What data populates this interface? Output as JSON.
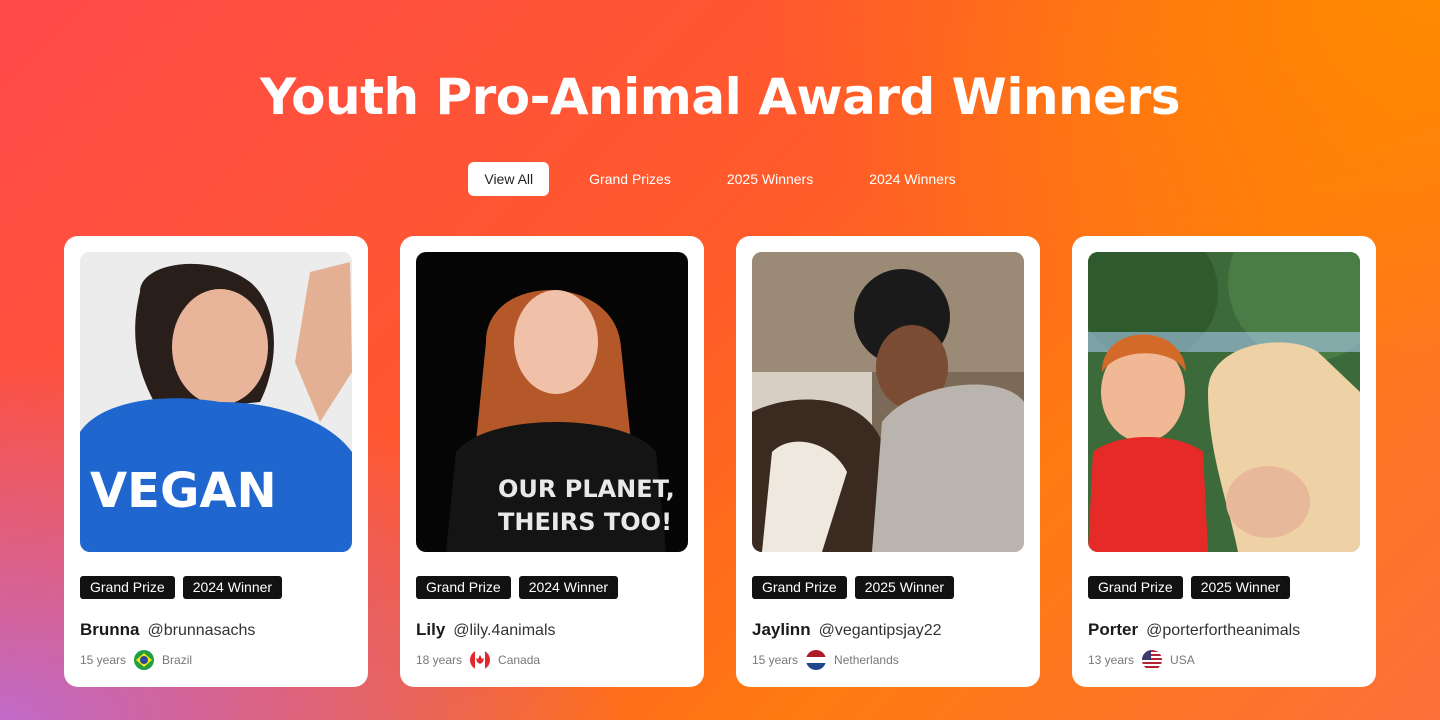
{
  "page": {
    "title": "Youth Pro-Animal Award Winners"
  },
  "filters": [
    {
      "label": "View All",
      "active": true
    },
    {
      "label": "Grand Prizes",
      "active": false
    },
    {
      "label": "2025 Winners",
      "active": false
    },
    {
      "label": "2024 Winners",
      "active": false
    }
  ],
  "cards": [
    {
      "name": "Brunna",
      "handle": "@brunnasachs",
      "age": "15 years",
      "country": "Brazil",
      "flag": "brazil-flag-icon",
      "badges": [
        "Grand Prize",
        "2024 Winner"
      ]
    },
    {
      "name": "Lily",
      "handle": "@lily.4animals",
      "age": "18 years",
      "country": "Canada",
      "flag": "canada-flag-icon",
      "badges": [
        "Grand Prize",
        "2024 Winner"
      ]
    },
    {
      "name": "Jaylinn",
      "handle": "@vegantipsjay22",
      "age": "15 years",
      "country": "Netherlands",
      "flag": "netherlands-flag-icon",
      "badges": [
        "Grand Prize",
        "2025 Winner"
      ]
    },
    {
      "name": "Porter",
      "handle": "@porterfortheanimals",
      "age": "13 years",
      "country": "USA",
      "flag": "usa-flag-icon",
      "badges": [
        "Grand Prize",
        "2025 Winner"
      ]
    }
  ],
  "photo_texts": {
    "brunna_shirt": "VEGAN",
    "lily_shirt_line1": "OUR PLANET,",
    "lily_shirt_line2": "THEIRS TOO!"
  }
}
